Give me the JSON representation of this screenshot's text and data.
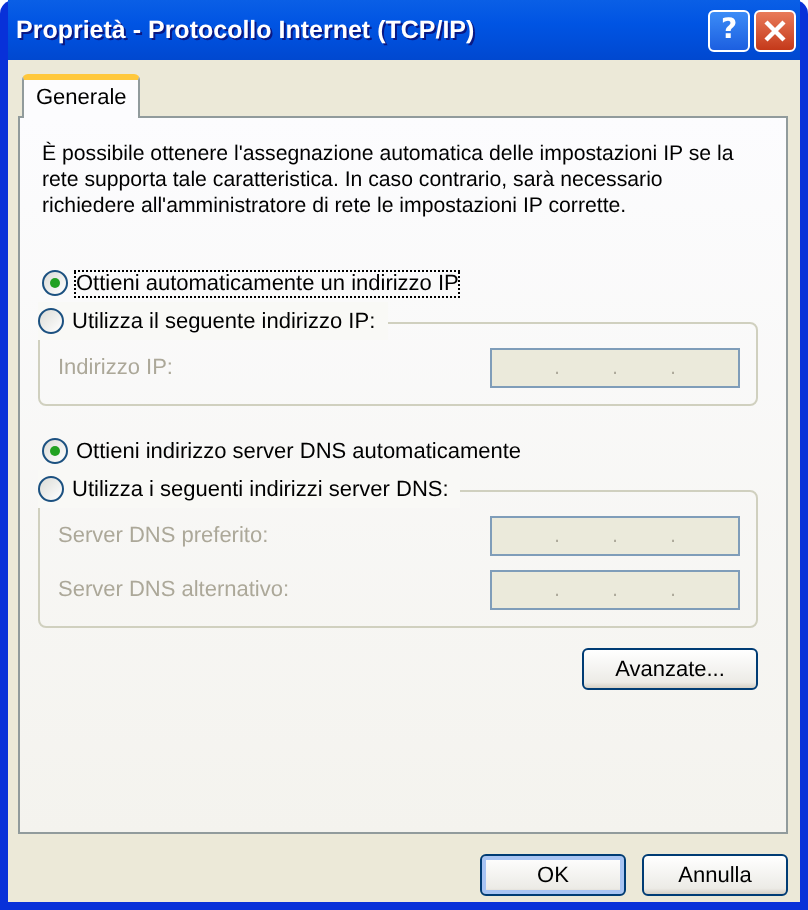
{
  "window": {
    "title": "Proprietà - Protocollo Internet (TCP/IP)",
    "title_buttons": [
      {
        "kind": "help",
        "label": "?"
      },
      {
        "kind": "close"
      }
    ]
  },
  "tabs": [
    {
      "label": "Generale",
      "selected": true
    }
  ],
  "description": "È possibile ottenere l'assegnazione automatica delle impostazioni IP se la rete supporta tale caratteristica. In caso contrario, sarà necessario richiedere all'amministratore di rete le impostazioni IP corrette.",
  "ip_section": {
    "auto_option": {
      "label": "Ottieni automaticamente un indirizzo IP",
      "selected": true,
      "focused": true
    },
    "manual_option": {
      "label": "Utilizza il seguente indirizzo IP:",
      "selected": false
    },
    "fields": [
      {
        "label": "Indirizzo IP:",
        "disabled": true,
        "separators": [
          ".",
          ".",
          "."
        ]
      }
    ]
  },
  "dns_section": {
    "auto_option": {
      "label": "Ottieni indirizzo server DNS automaticamente",
      "selected": true,
      "focused": false
    },
    "manual_option": {
      "label": "Utilizza i seguenti indirizzi server DNS:",
      "selected": false
    },
    "fields": [
      {
        "label": "Server DNS preferito:",
        "disabled": true,
        "separators": [
          ".",
          ".",
          "."
        ]
      },
      {
        "label": "Server DNS alternativo:",
        "disabled": true,
        "separators": [
          ".",
          ".",
          "."
        ]
      }
    ]
  },
  "advanced_button": "Avanzate...",
  "buttons": [
    {
      "label": "OK",
      "default": true
    },
    {
      "label": "Annulla",
      "default": false
    }
  ]
}
